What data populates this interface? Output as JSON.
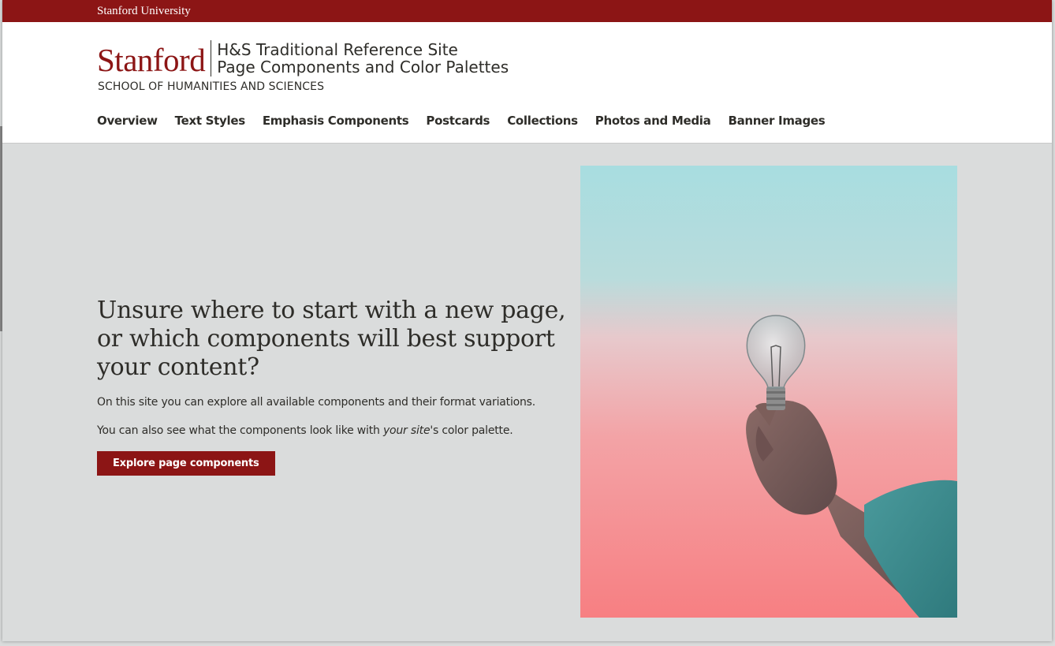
{
  "topbar": {
    "label": "Stanford University"
  },
  "brand": {
    "wordmark": "Stanford",
    "site_title_line1": "H&S Traditional Reference Site",
    "site_title_line2": "Page Components and Color Palettes",
    "school": "SCHOOL OF HUMANITIES AND SCIENCES"
  },
  "nav": {
    "items": [
      {
        "label": "Overview"
      },
      {
        "label": "Text Styles"
      },
      {
        "label": "Emphasis Components"
      },
      {
        "label": "Postcards"
      },
      {
        "label": "Collections"
      },
      {
        "label": "Photos and Media"
      },
      {
        "label": "Banner Images"
      }
    ]
  },
  "hero": {
    "title": "Unsure where to start with a new page, or which components will best support your content?",
    "p1": "On this site you can explore all available components and their format variations.",
    "p2_prefix": "You can also see what the components look like with ",
    "p2_em": "your site",
    "p2_suffix": "'s color palette.",
    "button_label": "Explore page components",
    "image_subject": "lightbulb-hand-photo"
  },
  "colors": {
    "brand_red": "#8c1515",
    "page_bg": "#dadcdc",
    "text": "#2e2d29"
  }
}
